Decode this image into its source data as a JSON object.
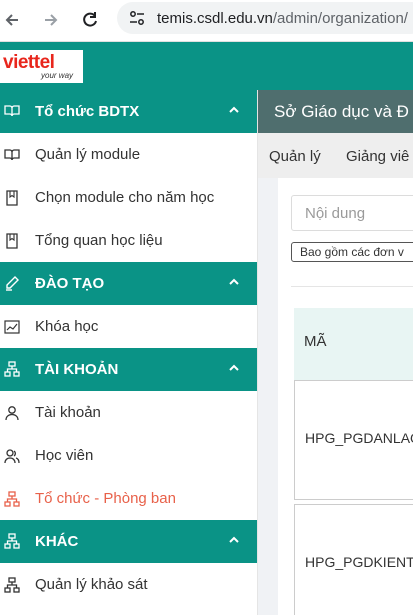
{
  "browser": {
    "back_icon": "arrow-left-icon",
    "forward_icon": "arrow-right-icon",
    "reload_icon": "reload-icon",
    "url_host": "temis.csdl.edu.vn",
    "url_path": "/admin/organization/"
  },
  "header": {
    "logo_text": "viettel",
    "logo_tagline": "your way",
    "brand_color": "#0a9386"
  },
  "sidebar": {
    "sections": [
      {
        "title": "Tổ chức BDTX",
        "icon": "book-open-icon",
        "items": [
          {
            "label": "Quản lý module",
            "icon": "book-open-icon"
          },
          {
            "label": "Chọn module cho năm học",
            "icon": "bookmark-icon"
          },
          {
            "label": "Tổng quan học liệu",
            "icon": "bookmark-icon"
          }
        ]
      },
      {
        "title": "ĐÀO TẠO",
        "icon": "pencil-icon",
        "items": [
          {
            "label": "Khóa học",
            "icon": "chart-line-icon"
          }
        ]
      },
      {
        "title": "TÀI KHOẢN",
        "icon": "org-chart-icon",
        "items": [
          {
            "label": "Tài khoản",
            "icon": "user-icon"
          },
          {
            "label": "Học viên",
            "icon": "users-icon"
          },
          {
            "label": "Tổ chức - Phòng ban",
            "icon": "org-chart-icon",
            "active": true
          }
        ]
      },
      {
        "title": "KHÁC",
        "icon": "org-chart-icon",
        "items": [
          {
            "label": "Quản lý khảo sát",
            "icon": "org-chart-icon"
          }
        ]
      }
    ],
    "active_color": "#e8614a"
  },
  "main": {
    "banner_title": "Sở Giáo dục và Đ",
    "tabs": [
      "Quản lý",
      "Giảng viê"
    ],
    "search_placeholder": "Nội dung",
    "filter_chip": "Bao gồm các đơn v",
    "table": {
      "columns": [
        "MÃ"
      ],
      "rows": [
        [
          "HPG_PGDANLAO"
        ],
        [
          "HPG_PGDKIENT"
        ]
      ]
    }
  }
}
